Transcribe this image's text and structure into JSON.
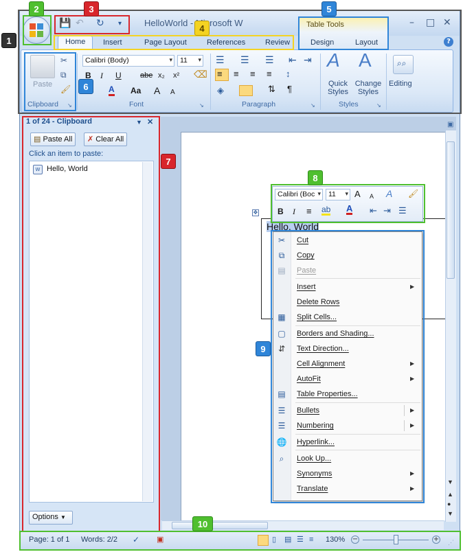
{
  "window": {
    "title": "HelloWorld - Microsoft W",
    "controls": {
      "minimize": "–",
      "maximize": "□",
      "close": "✕",
      "help": "?"
    }
  },
  "office_button": {
    "icon": "office-logo-icon"
  },
  "quick_access": {
    "save": "💾",
    "undo": "↶",
    "redo": "↻",
    "customize": "▾"
  },
  "ribbon_tabs": [
    "Home",
    "Insert",
    "Page Layout",
    "References",
    "Review"
  ],
  "contextual_tabs": {
    "title": "Table Tools",
    "tabs": [
      "Design",
      "Layout"
    ]
  },
  "ribbon": {
    "clipboard": {
      "label": "Clipboard",
      "paste": "Paste"
    },
    "font": {
      "label": "Font",
      "font_name": "Calibri (Body)",
      "font_size": "11",
      "bold": "B",
      "italic": "I",
      "underline": "U",
      "strike": "abe",
      "sub": "x₂",
      "sup": "x²",
      "color_a": "A",
      "case": "Aa",
      "grow": "A",
      "shrink": "A"
    },
    "paragraph": {
      "label": "Paragraph",
      "pilcrow": "¶"
    },
    "styles": {
      "label": "Styles",
      "quick": "Quick Styles",
      "change": "Change Styles"
    },
    "editing": {
      "label": "Editing"
    }
  },
  "clipboard_pane": {
    "title": "1 of 24 - Clipboard",
    "paste_all": "Paste All",
    "clear_all": "Clear All",
    "instruction": "Click an item to paste:",
    "items": [
      "Hello, World"
    ],
    "options": "Options"
  },
  "document": {
    "cell_text": "Hello, World"
  },
  "mini_toolbar": {
    "font_name": "Calibri (Boc",
    "font_size": "11",
    "bold": "B",
    "italic": "I"
  },
  "context_menu": {
    "items": [
      {
        "label": "Cut",
        "icon": "cut-icon",
        "disabled": false
      },
      {
        "label": "Copy",
        "icon": "copy-icon",
        "disabled": false
      },
      {
        "label": "Paste",
        "icon": "paste-icon",
        "disabled": true
      },
      {
        "label": "Insert",
        "submenu": true
      },
      {
        "label": "Delete Rows"
      },
      {
        "label": "Split Cells...",
        "icon": "split-cells-icon"
      },
      {
        "label": "Borders and Shading...",
        "icon": "borders-icon"
      },
      {
        "label": "Text Direction...",
        "icon": "text-direction-icon"
      },
      {
        "label": "Cell Alignment",
        "submenu": true
      },
      {
        "label": "AutoFit",
        "submenu": true
      },
      {
        "label": "Table Properties...",
        "icon": "table-properties-icon"
      },
      {
        "label": "Bullets",
        "icon": "bullets-icon",
        "submenu": true
      },
      {
        "label": "Numbering",
        "icon": "numbering-icon",
        "submenu": true
      },
      {
        "label": "Hyperlink...",
        "icon": "hyperlink-icon"
      },
      {
        "label": "Look Up...",
        "icon": "look-up-icon"
      },
      {
        "label": "Synonyms",
        "submenu": true
      },
      {
        "label": "Translate",
        "submenu": true
      }
    ]
  },
  "status_bar": {
    "page": "Page: 1 of 1",
    "words": "Words: 2/2",
    "zoom": "130%"
  },
  "callouts": [
    "1",
    "2",
    "3",
    "4",
    "5",
    "6",
    "7",
    "8",
    "9",
    "10"
  ],
  "colors": {
    "green": "#4fbf2f",
    "red": "#d8262c",
    "yellow": "#f4d322",
    "blue": "#2f85d8"
  }
}
